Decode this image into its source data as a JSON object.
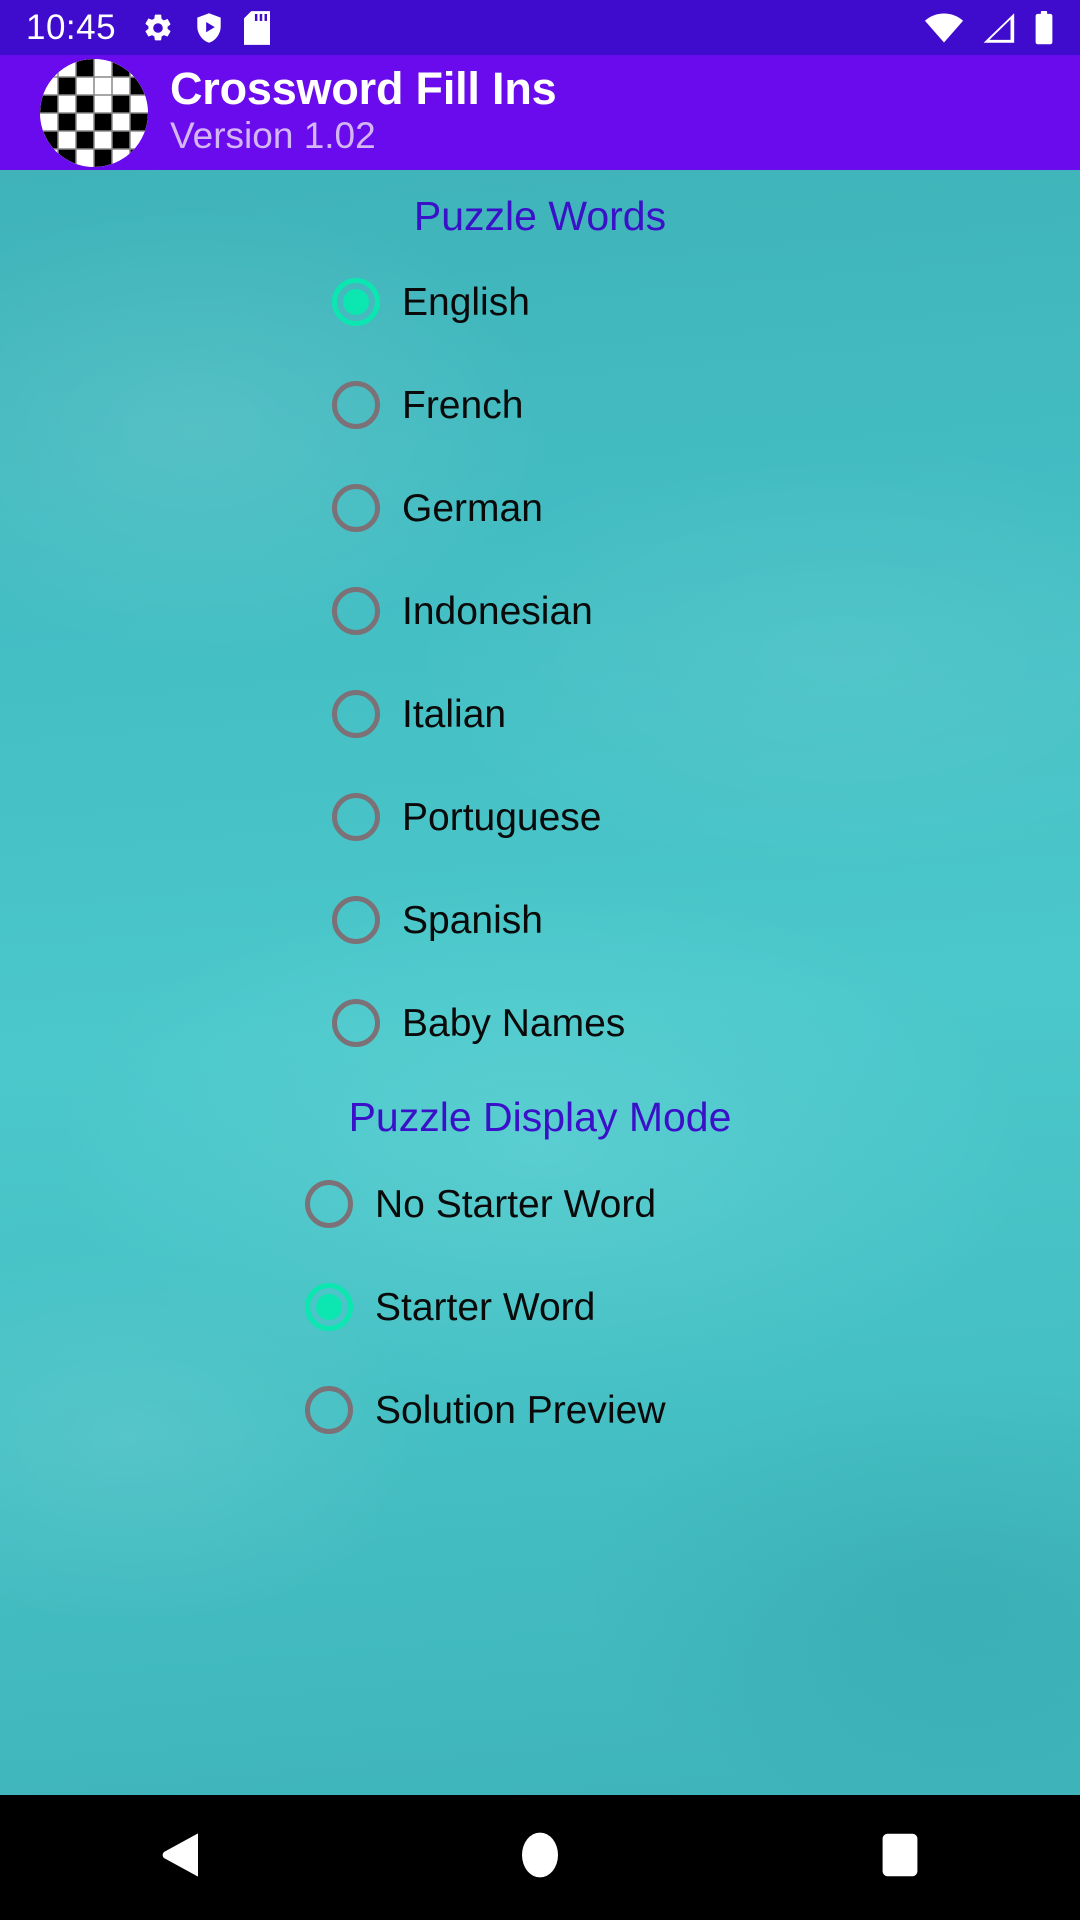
{
  "status_bar": {
    "time": "10:45",
    "left_icons": [
      "gear-icon",
      "shield-play-icon",
      "sd-card-icon"
    ],
    "right_icons": [
      "wifi-icon",
      "cellular-signal-icon",
      "battery-icon"
    ],
    "background_color": "#3F0BCC"
  },
  "app_bar": {
    "icon": "crossword-grid-icon",
    "title": "Crossword Fill Ins",
    "version": "Version 1.02",
    "background_color": "#6A0BED",
    "title_color": "#FFFFFF",
    "version_color": "#D4B6F7"
  },
  "content": {
    "background_color": "#45C0C4",
    "heading_color": "#3A10C8",
    "selected_color": "#0CE6B0",
    "unselected_color": "#7B7176",
    "label_color": "#0A0A0A",
    "sections": [
      {
        "title": "Puzzle Words",
        "options": [
          {
            "label": "English",
            "selected": true
          },
          {
            "label": "French",
            "selected": false
          },
          {
            "label": "German",
            "selected": false
          },
          {
            "label": "Indonesian",
            "selected": false
          },
          {
            "label": "Italian",
            "selected": false
          },
          {
            "label": "Portuguese",
            "selected": false
          },
          {
            "label": "Spanish",
            "selected": false
          },
          {
            "label": "Baby Names",
            "selected": false
          }
        ]
      },
      {
        "title": "Puzzle Display Mode",
        "options": [
          {
            "label": "No Starter Word",
            "selected": false
          },
          {
            "label": "Starter Word",
            "selected": true
          },
          {
            "label": "Solution Preview",
            "selected": false
          }
        ]
      }
    ]
  },
  "nav_bar": {
    "background_color": "#000000",
    "buttons": [
      {
        "name": "back-button",
        "icon": "triangle-left-icon"
      },
      {
        "name": "home-button",
        "icon": "circle-icon"
      },
      {
        "name": "recents-button",
        "icon": "square-icon"
      }
    ]
  }
}
